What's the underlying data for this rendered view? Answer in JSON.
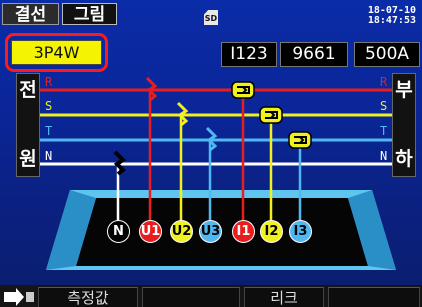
{
  "tabs": [
    {
      "label": "결선",
      "active": true
    },
    {
      "label": "그림",
      "active": false
    }
  ],
  "status": {
    "storage_icon": "sd-card-icon",
    "storage_label": "SD",
    "date": "18-07-10",
    "time": "18:47:53"
  },
  "settings": {
    "wiring": "3P4W",
    "clamp": "I123",
    "clamp_model": "9661",
    "range": "500A"
  },
  "diagram": {
    "source_label_top": "전",
    "source_label_bottom": "원",
    "load_label_top": "부",
    "load_label_bottom": "하",
    "lines": [
      {
        "label": "R",
        "color": "#e81e1e"
      },
      {
        "label": "S",
        "color": "#f0f020"
      },
      {
        "label": "T",
        "color": "#4fb8f0"
      },
      {
        "label": "N",
        "color": "#ffffff"
      }
    ],
    "terminals": [
      {
        "label": "N",
        "fill": "#000000",
        "text_color": "#ffffff"
      },
      {
        "label": "U1",
        "fill": "#e81e1e",
        "text_color": "#ffffff"
      },
      {
        "label": "U2",
        "fill": "#f0f020",
        "text_color": "#000000"
      },
      {
        "label": "U3",
        "fill": "#4fb8f0",
        "text_color": "#000000"
      },
      {
        "label": "I1",
        "fill": "#e81e1e",
        "text_color": "#ffffff"
      },
      {
        "label": "I2",
        "fill": "#f0f020",
        "text_color": "#000000"
      },
      {
        "label": "I3",
        "fill": "#4fb8f0",
        "text_color": "#000000"
      }
    ]
  },
  "footer": {
    "icon": "menu-arrow-icon",
    "buttons": [
      {
        "label": "측정값"
      },
      {
        "label": ""
      },
      {
        "label": "리크"
      },
      {
        "label": ""
      }
    ]
  }
}
